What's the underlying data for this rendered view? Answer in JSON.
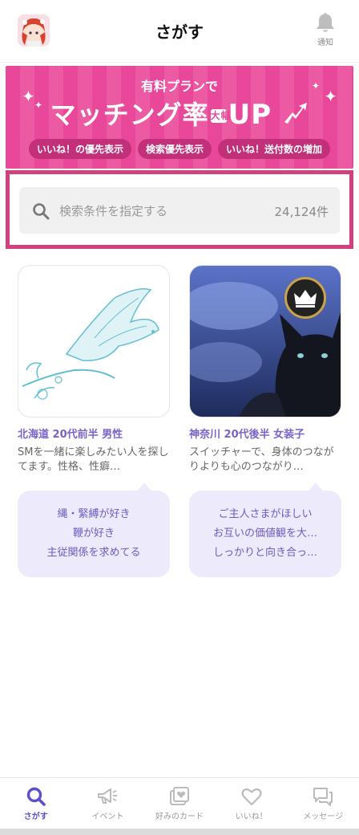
{
  "header": {
    "title": "さがす",
    "notification_label": "通知"
  },
  "banner": {
    "subtitle": "有料プランで",
    "title_main": "マッチング率",
    "title_badge": "大幅",
    "title_up": "UP",
    "pills": [
      "いいね！の優先表示",
      "検索優先表示",
      "いいね！送付数の増加"
    ],
    "background_color": "#e8479a"
  },
  "search": {
    "placeholder": "検索条件を指定する",
    "count": "24,124件",
    "highlight_color": "#d2407f"
  },
  "cards": [
    {
      "meta": "北海道 20代前半 男性",
      "description": "SMを一緒に楽しみたい人を探してます。性格、性癖…",
      "tags": [
        "縄・緊縛が好き",
        "鞭が好き",
        "主従関係を求めてる"
      ]
    },
    {
      "meta": "神奈川 20代後半 女装子",
      "description": "スイッチャーで、身体のつながりよりも心のつながり…",
      "tags": [
        "ご主人さまがほしい",
        "お互いの価値観を大…",
        "しっかりと向き合っ…"
      ]
    }
  ],
  "nav": {
    "items": [
      {
        "label": "さがす",
        "icon": "search-icon",
        "active": true
      },
      {
        "label": "イベント",
        "icon": "megaphone-icon",
        "active": false
      },
      {
        "label": "好みのカード",
        "icon": "cards-icon",
        "active": false
      },
      {
        "label": "いいね！",
        "icon": "heart-icon",
        "active": false
      },
      {
        "label": "メッセージ",
        "icon": "chat-icon",
        "active": false
      }
    ],
    "active_color": "#5a4fd0"
  }
}
